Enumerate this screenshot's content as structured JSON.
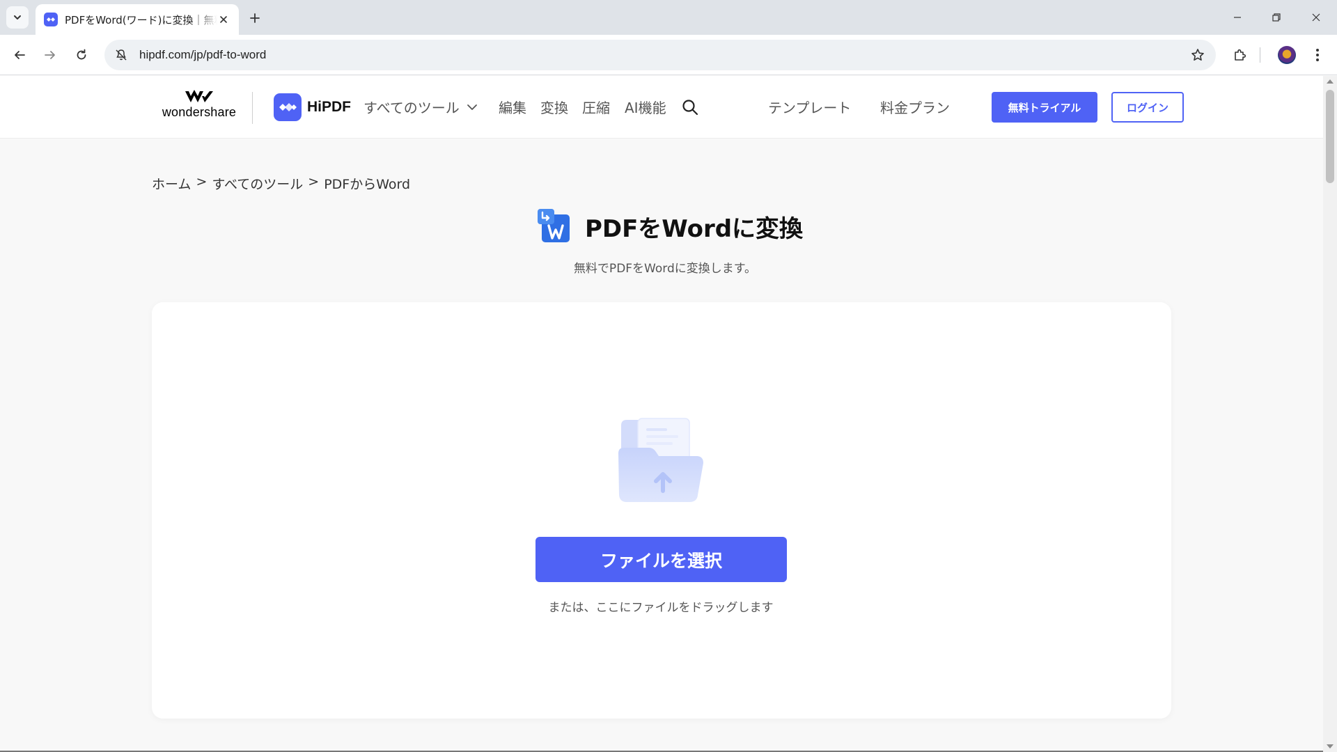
{
  "browser": {
    "tab_title": "PDFをWord(ワード)に変換｜無料オンライン",
    "url": "hipdf.com/jp/pdf-to-word"
  },
  "site": {
    "brand": "wondershare",
    "product": "HiPDF",
    "nav": {
      "all_tools": "すべてのツール",
      "edit": "編集",
      "convert": "変換",
      "compress": "圧縮",
      "ai": "AI機能",
      "templates": "テンプレート",
      "pricing": "料金プラン"
    },
    "trial_button": "無料トライアル",
    "login_button": "ログイン"
  },
  "breadcrumb": {
    "home": "ホーム",
    "sep1": ">",
    "all_tools": "すべてのツール",
    "sep2": ">",
    "current": "PDFからWord"
  },
  "page": {
    "title": "PDFをWordに変換",
    "subtitle": "無料でPDFをWordに変換します。"
  },
  "upload": {
    "select_button": "ファイルを選択",
    "drag_hint": "または、ここにファイルをドラッグします"
  },
  "colors": {
    "accent": "#4f62f5"
  }
}
